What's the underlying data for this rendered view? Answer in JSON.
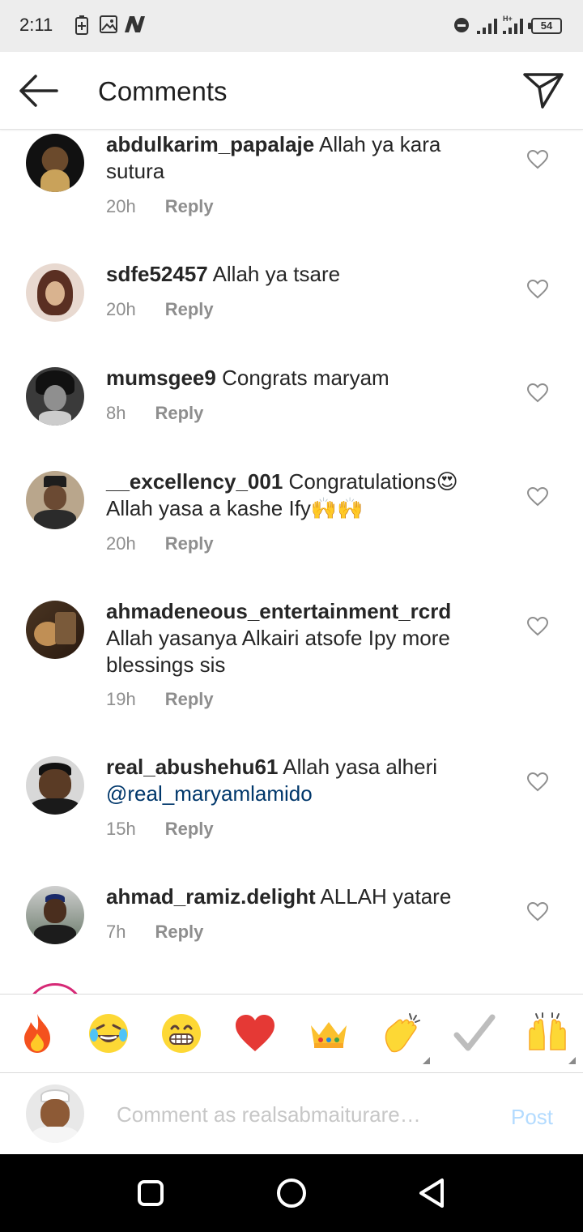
{
  "status_bar": {
    "time": "2:11",
    "battery_level": "54",
    "network_type": "H+",
    "icons": [
      "battery-saver-icon",
      "gallery-icon",
      "n-app-icon",
      "dnd-icon",
      "signal-icon",
      "signal-h-plus-icon",
      "battery-icon"
    ]
  },
  "header": {
    "title": "Comments",
    "back_icon": "arrow-left-icon",
    "send_icon": "paper-plane-icon"
  },
  "comments": [
    {
      "username": "abdulkarim_papalaje",
      "text": "Allah ya kara sutura",
      "time": "20h",
      "reply": "Reply"
    },
    {
      "username": "sdfe52457",
      "text": "Allah ya tsare",
      "time": "20h",
      "reply": "Reply"
    },
    {
      "username": "mumsgee9",
      "text": "Congrats maryam",
      "time": "8h",
      "reply": "Reply"
    },
    {
      "username": "__excellency_001",
      "text": "Congratulations😍 Allah yasa a kashe Ify🙌🙌",
      "time": "20h",
      "reply": "Reply"
    },
    {
      "username": "ahmadeneous_entertainment_rcrd",
      "text": "Allah yasanya Alkairi atsofe Ipy more blessings sis",
      "time": "19h",
      "reply": "Reply"
    },
    {
      "username": "real_abushehu61",
      "text": "Allah yasa alheri",
      "mention": "@real_maryamlamido",
      "time": "15h",
      "reply": "Reply"
    },
    {
      "username": "ahmad_ramiz.delight",
      "text": "ALLAH yatare",
      "time": "7h",
      "reply": "Reply"
    }
  ],
  "emoji_bar": [
    "🔥",
    "😂",
    "😁",
    "❤️",
    "👑",
    "👏",
    "✔️",
    "🙌"
  ],
  "comment_input": {
    "placeholder": "Comment as realsabmaiturare…",
    "post_label": "Post"
  },
  "nav_bar": [
    "recents-icon",
    "home-icon",
    "back-icon"
  ]
}
